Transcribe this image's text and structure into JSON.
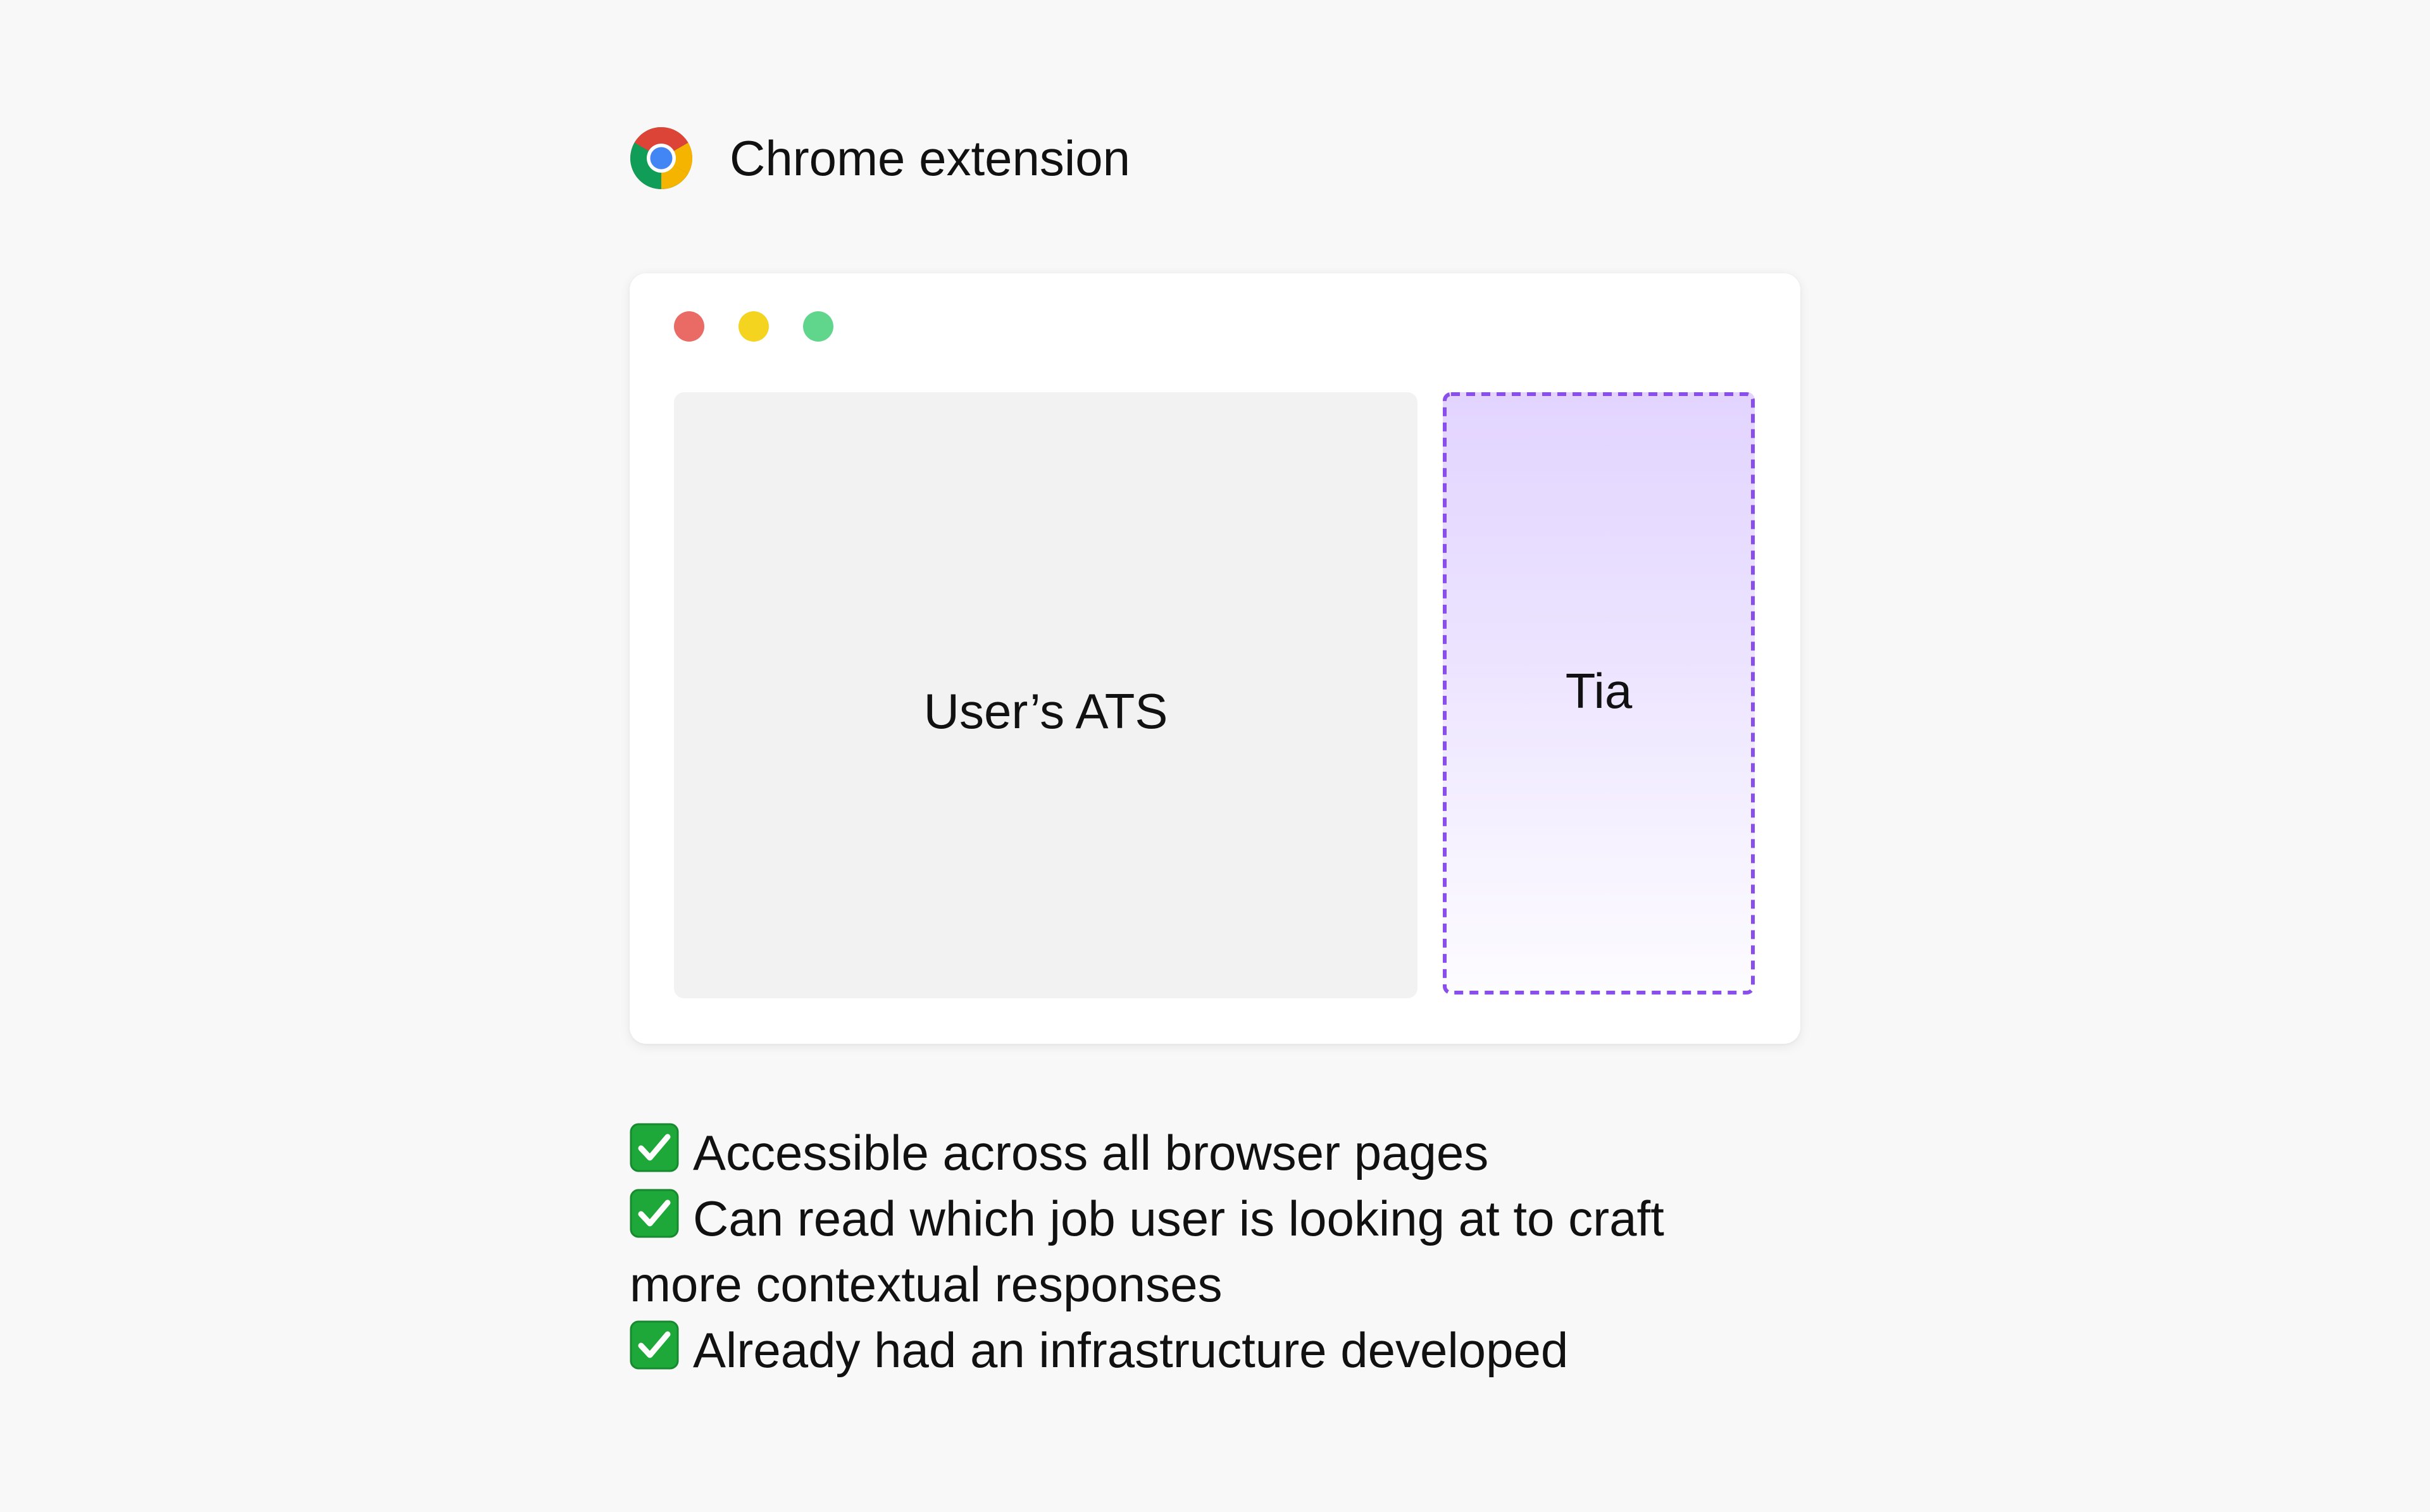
{
  "header": {
    "icon": "chrome-logo-icon",
    "title": "Chrome extension"
  },
  "window": {
    "dots": [
      {
        "name": "close",
        "color": "#ea6b66"
      },
      {
        "name": "minimize",
        "color": "#f5d41f"
      },
      {
        "name": "maximize",
        "color": "#5fd68c"
      }
    ],
    "main_pane_label": "User’s ATS",
    "side_panel_label": "Tia",
    "side_panel_border_color": "#8a4fea"
  },
  "bullets": [
    {
      "icon": "check-mark-button-icon",
      "text": "Accessible across all browser pages"
    },
    {
      "icon": "check-mark-button-icon",
      "text": "Can read which job user is looking at to craft more contextual responses"
    },
    {
      "icon": "check-mark-button-icon",
      "text": "Already had an infrastructure developed"
    }
  ],
  "colors": {
    "background": "#f8f8f8",
    "card": "#ffffff",
    "ats_pane": "#f2f2f2",
    "tia_gradient_top": "#e2d4ff",
    "tia_gradient_bottom": "#fdfcff",
    "check_green": "#1fa83a"
  }
}
